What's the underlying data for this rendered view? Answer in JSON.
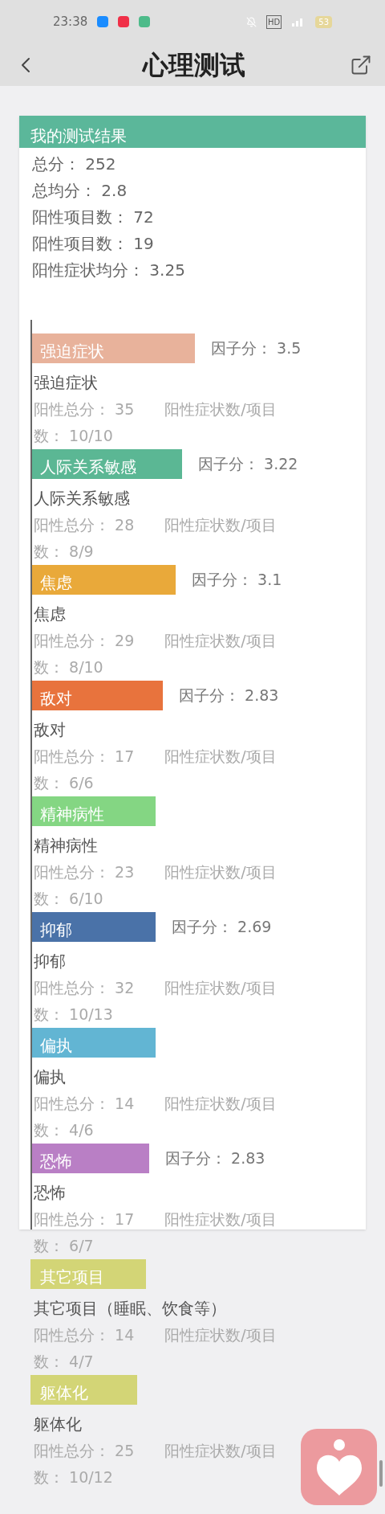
{
  "status_bar": {
    "time": "23:38",
    "network": "HD",
    "battery": "53"
  },
  "header": {
    "title": "心理测试"
  },
  "card": {
    "title": "我的测试结果",
    "summary": [
      "总分： 252",
      "总均分： 2.8",
      "阳性项目数： 72",
      "阳性项目数： 19",
      "阳性症状均分： 3.25"
    ]
  },
  "factors": [
    {
      "name": "强迫症状",
      "color": "#e8b29b",
      "factor": "因子分： 3.5",
      "title": "强迫症状",
      "details": [
        "阳性总分： 35　　阳性症状数/项目",
        "数： 10/10"
      ]
    },
    {
      "name": "人际关系敏感",
      "color": "#5bb794",
      "factor": "因子分： 3.22",
      "title": "人际关系敏感",
      "details": [
        "阳性总分： 28　　阳性症状数/项目",
        "数： 8/9"
      ]
    },
    {
      "name": "焦虑",
      "color": "#e9a93a",
      "factor": "因子分： 3.1",
      "title": "焦虑",
      "details": [
        "阳性总分： 29　　阳性症状数/项目",
        "数： 8/10"
      ]
    },
    {
      "name": "敌对",
      "color": "#e8733d",
      "factor": "因子分： 2.83",
      "title": "敌对",
      "details": [
        "阳性总分： 17　　阳性症状数/项目",
        "数： 6/6"
      ]
    },
    {
      "name": "精神病性",
      "color": "#84d683",
      "title": "精神病性",
      "details": [
        "阳性总分： 23　　阳性症状数/项目",
        "数： 6/10"
      ]
    },
    {
      "name": "抑郁",
      "color": "#4a72a8",
      "factor": "因子分： 2.69",
      "title": "抑郁",
      "details": [
        "阳性总分： 32　　阳性症状数/项目",
        "数： 10/13"
      ]
    },
    {
      "name": "偏执",
      "color": "#62b5d3",
      "title": "偏执",
      "details": [
        "阳性总分： 14　　阳性症状数/项目",
        "数： 4/6"
      ]
    },
    {
      "name": "恐怖",
      "color": "#b97fc5",
      "factor": "因子分： 2.83",
      "title": "恐怖",
      "details": [
        "阳性总分： 17　　阳性症状数/项目",
        "数： 6/7"
      ]
    },
    {
      "name": "其它项目",
      "color": "#d3d576",
      "title": "其它项目（睡眠、饮食等）",
      "details": [
        "阳性总分： 14　　阳性症状数/项目",
        "数： 4/7"
      ]
    },
    {
      "name": "躯体化",
      "color": "#d3d576",
      "title": "躯体化",
      "details": [
        "阳性总分： 25　　阳性症状数/项目",
        "数： 10/12"
      ]
    }
  ]
}
